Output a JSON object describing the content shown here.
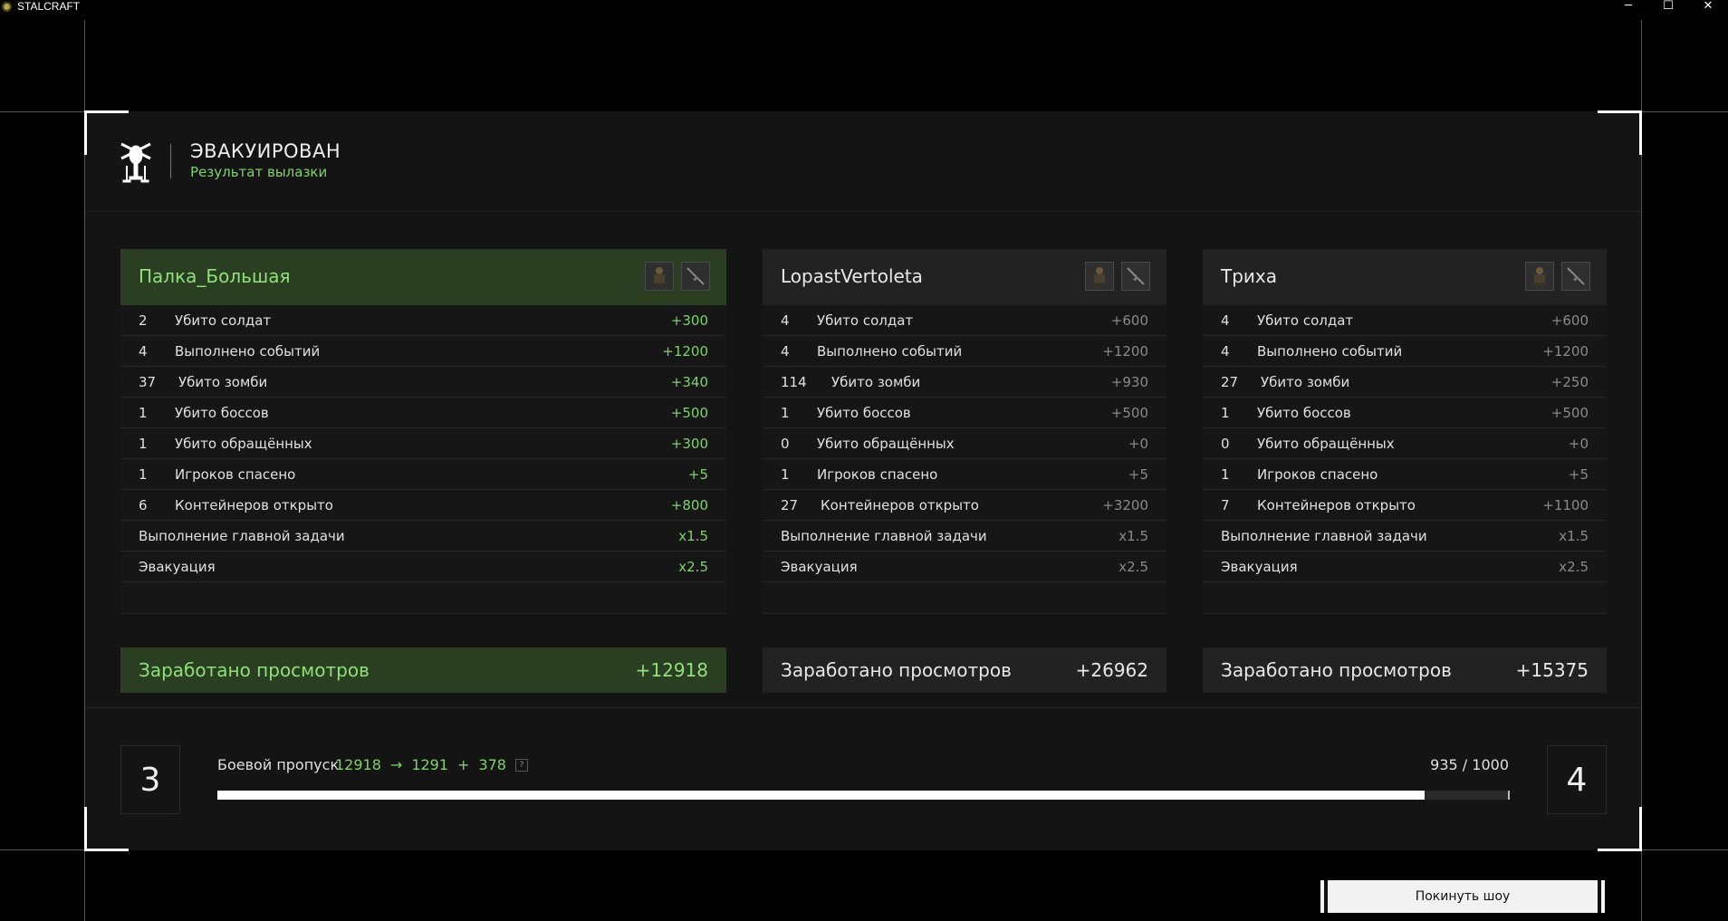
{
  "window": {
    "title": "STALCRAFT",
    "minimize": "─",
    "maximize": "☐",
    "close": "✕"
  },
  "header": {
    "title": "ЭВАКУИРОВАН",
    "subtitle": "Результат вылазки"
  },
  "players": [
    {
      "name": "Палка_Большая",
      "rows": [
        {
          "num": "2",
          "label": "Убито солдат",
          "points": "+300"
        },
        {
          "num": "4",
          "label": "Выполнено событий",
          "points": "+1200"
        },
        {
          "num": "37",
          "label": "Убито зомби",
          "points": "+340"
        },
        {
          "num": "1",
          "label": "Убито боссов",
          "points": "+500"
        },
        {
          "num": "1",
          "label": "Убито обращённых",
          "points": "+300"
        },
        {
          "num": "1",
          "label": "Игроков спасено",
          "points": "+5"
        },
        {
          "num": "6",
          "label": "Контейнеров открыто",
          "points": "+800"
        }
      ],
      "multipliers": [
        {
          "label": "Выполнение главной задачи",
          "value": "x1.5"
        },
        {
          "label": "Эвакуация",
          "value": "x2.5"
        }
      ],
      "total_label": "Заработано просмотров",
      "total": "+12918"
    },
    {
      "name": "LopastVertoleta",
      "rows": [
        {
          "num": "4",
          "label": "Убито солдат",
          "points": "+600"
        },
        {
          "num": "4",
          "label": "Выполнено событий",
          "points": "+1200"
        },
        {
          "num": "114",
          "label": "Убито зомби",
          "points": "+930"
        },
        {
          "num": "1",
          "label": "Убито боссов",
          "points": "+500"
        },
        {
          "num": "0",
          "label": "Убито обращённых",
          "points": "+0"
        },
        {
          "num": "1",
          "label": "Игроков спасено",
          "points": "+5"
        },
        {
          "num": "27",
          "label": "Контейнеров открыто",
          "points": "+3200"
        }
      ],
      "multipliers": [
        {
          "label": "Выполнение главной задачи",
          "value": "x1.5"
        },
        {
          "label": "Эвакуация",
          "value": "x2.5"
        }
      ],
      "total_label": "Заработано просмотров",
      "total": "+26962"
    },
    {
      "name": "Триха",
      "rows": [
        {
          "num": "4",
          "label": "Убито солдат",
          "points": "+600"
        },
        {
          "num": "4",
          "label": "Выполнено событий",
          "points": "+1200"
        },
        {
          "num": "27",
          "label": "Убито зомби",
          "points": "+250"
        },
        {
          "num": "1",
          "label": "Убито боссов",
          "points": "+500"
        },
        {
          "num": "0",
          "label": "Убито обращённых",
          "points": "+0"
        },
        {
          "num": "1",
          "label": "Игроков спасено",
          "points": "+5"
        },
        {
          "num": "7",
          "label": "Контейнеров открыто",
          "points": "+1100"
        }
      ],
      "multipliers": [
        {
          "label": "Выполнение главной задачи",
          "value": "x1.5"
        },
        {
          "label": "Эвакуация",
          "value": "x2.5"
        }
      ],
      "total_label": "Заработано просмотров",
      "total": "+15375"
    }
  ],
  "battle_pass": {
    "current_level": "3",
    "next_level": "4",
    "label": "Боевой пропуск",
    "earned": "12918",
    "arrow": "→",
    "converted": "1291",
    "plus": "+",
    "bonus": "378",
    "help": "?",
    "progress_text": "935 / 1000",
    "progress_fraction": 0.935
  },
  "leave_button": "Покинуть шоу",
  "colors": {
    "accent_green": "#7ed36a",
    "highlight_bg": "#2a3f22",
    "panel_bg": "#141414"
  },
  "icons": {
    "header": "helicopter-icon",
    "slot_armor": "armor-icon",
    "slot_weapon": "rifle-icon"
  }
}
